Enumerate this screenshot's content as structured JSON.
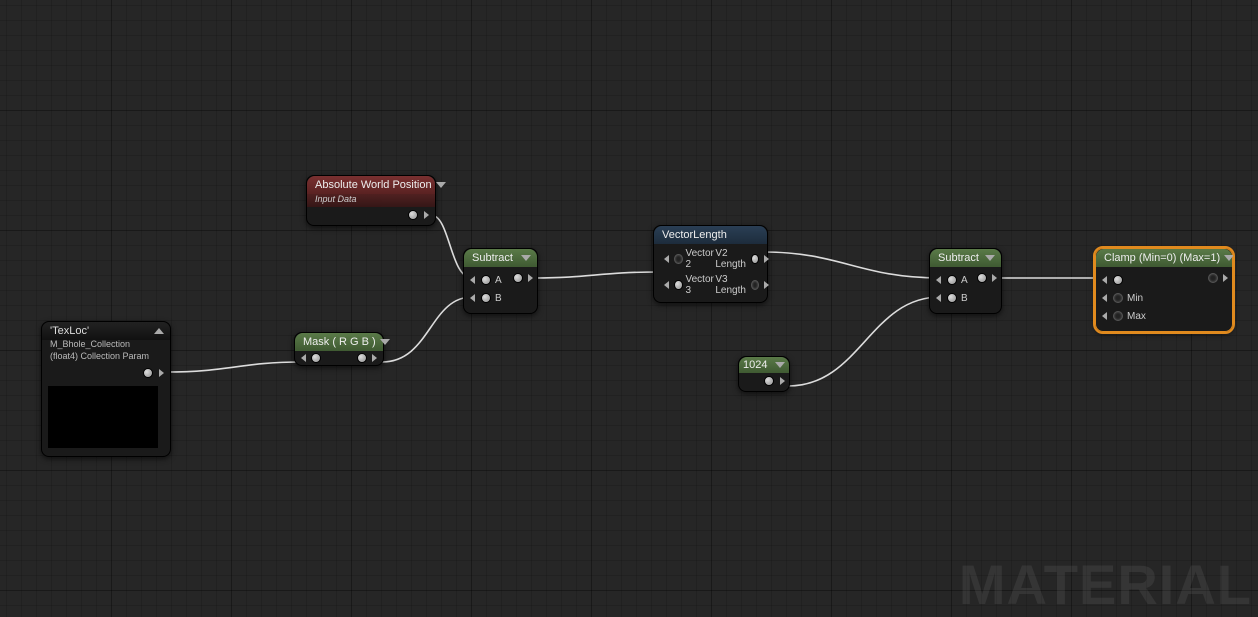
{
  "watermark": "MATERIAL",
  "nodes": {
    "texloc": {
      "title": "'TexLoc'",
      "subtitle1": "M_Bhole_Collection",
      "subtitle2": "(float4) Collection Param"
    },
    "awp": {
      "title": "Absolute World Position",
      "subtitle": "Input Data"
    },
    "mask": {
      "title": "Mask ( R G B )"
    },
    "subtract1": {
      "title": "Subtract",
      "inA": "A",
      "inB": "B"
    },
    "vectorlength": {
      "title": "VectorLength",
      "in1": "Vector 2",
      "in2": "Vector 3",
      "out1": "V2 Length",
      "out2": "V3 Length"
    },
    "const1024": {
      "title": "1024"
    },
    "subtract2": {
      "title": "Subtract",
      "inA": "A",
      "inB": "B"
    },
    "clamp": {
      "title": "Clamp (Min=0) (Max=1)",
      "inMain": "",
      "inMin": "Min",
      "inMax": "Max"
    }
  }
}
